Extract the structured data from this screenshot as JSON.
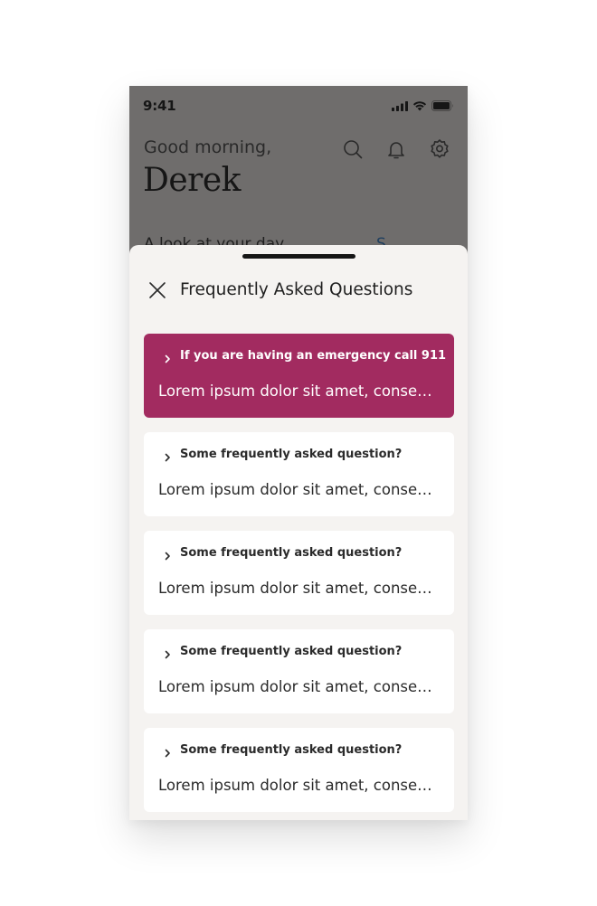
{
  "status_bar": {
    "time": "9:41",
    "icons": [
      "cellular-signal-icon",
      "wifi-icon",
      "battery-icon"
    ]
  },
  "header": {
    "greeting": "Good morning,",
    "user_name": "Derek",
    "icons": [
      "search-icon",
      "bell-icon",
      "gear-icon"
    ]
  },
  "background_content": {
    "section_title": "A look at your day",
    "link_text": "S"
  },
  "sheet": {
    "title": "Frequently Asked Questions",
    "close_icon": "close-icon",
    "items": [
      {
        "question": "If you are having an emergency call 911",
        "answer": "Lorem ipsum dolor sit amet, consectetur adipiscing elit",
        "style": "emergency"
      },
      {
        "question": "Some frequently asked question?",
        "answer": "Lorem ipsum dolor sit amet, consectetur adipiscing elit",
        "style": "default"
      },
      {
        "question": "Some frequently asked question?",
        "answer": "Lorem ipsum dolor sit amet, consectetur adipiscing elit",
        "style": "default"
      },
      {
        "question": "Some frequently asked question?",
        "answer": "Lorem ipsum dolor sit amet, consectetur adipiscing elit",
        "style": "default"
      },
      {
        "question": "Some frequently asked question?",
        "answer": "Lorem ipsum dolor sit amet, consectetur adipiscing elit",
        "style": "default"
      }
    ]
  },
  "colors": {
    "emergency": "#A22B60",
    "backdrop": "#6F6D6C",
    "sheet_background": "#F5F3F1",
    "card_background": "#FFFFFF",
    "text_primary": "#2A2A2A"
  }
}
